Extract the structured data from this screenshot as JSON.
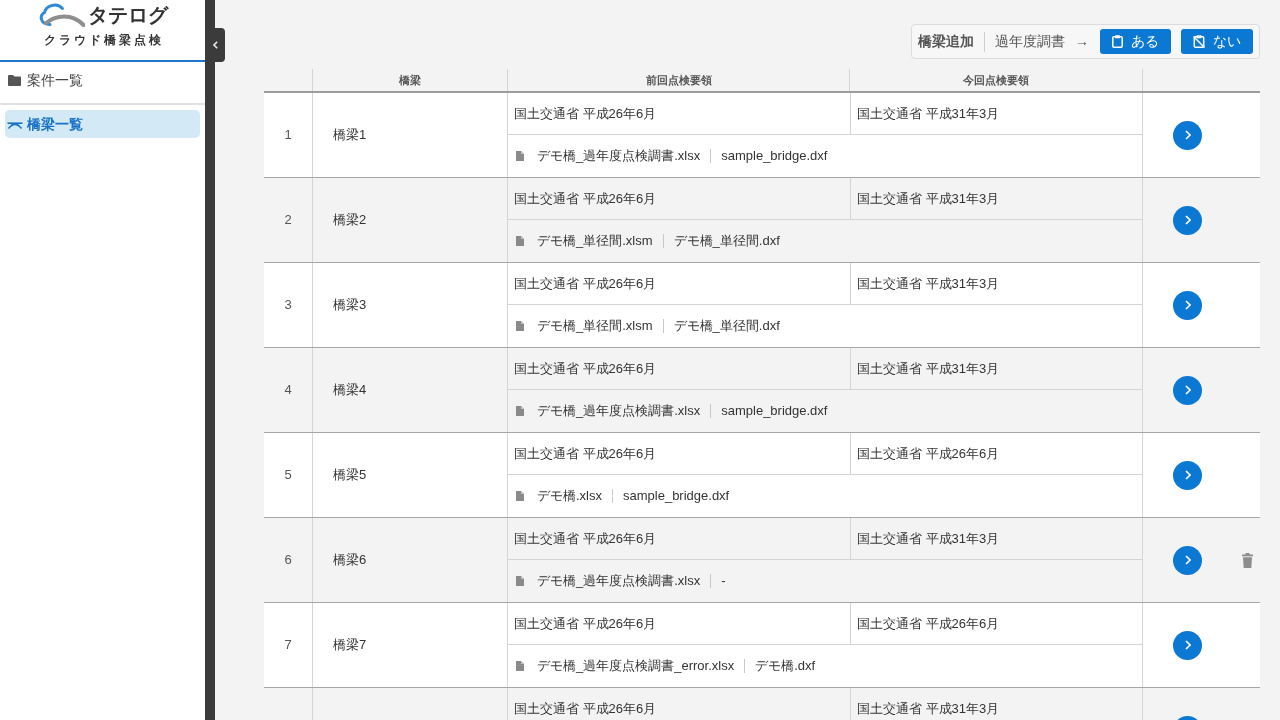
{
  "sidebar": {
    "logo": {
      "title": "タテログ",
      "subtitle": "クラウド橋梁点検"
    },
    "items": [
      {
        "label": "案件一覧",
        "kind": "folder",
        "selected": false
      },
      {
        "label": "橋梁一覧",
        "kind": "bridge",
        "selected": true
      }
    ]
  },
  "toolbar": {
    "title": "橋梁追加",
    "prompt": "過年度調書",
    "arrow": "→",
    "buttons": [
      {
        "label": "ある",
        "kind": "present"
      },
      {
        "label": "ない",
        "kind": "absent"
      }
    ]
  },
  "table": {
    "columns": [
      "橋梁",
      "前回点検要領",
      "今回点検要領"
    ],
    "rows": [
      {
        "number": "1",
        "name": "橋梁1",
        "previous": "国土交通省 平成26年6月",
        "current": "国土交通省 平成31年3月",
        "files": [
          "デモ橋_過年度点検調書.xlsx",
          "sample_bridge.dxf"
        ],
        "deletable": false
      },
      {
        "number": "2",
        "name": "橋梁2",
        "previous": "国土交通省 平成26年6月",
        "current": "国土交通省 平成31年3月",
        "files": [
          "デモ橋_単径間.xlsm",
          "デモ橋_単径間.dxf"
        ],
        "deletable": false
      },
      {
        "number": "3",
        "name": "橋梁3",
        "previous": "国土交通省 平成26年6月",
        "current": "国土交通省 平成31年3月",
        "files": [
          "デモ橋_単径間.xlsm",
          "デモ橋_単径間.dxf"
        ],
        "deletable": false
      },
      {
        "number": "4",
        "name": "橋梁4",
        "previous": "国土交通省 平成26年6月",
        "current": "国土交通省 平成31年3月",
        "files": [
          "デモ橋_過年度点検調書.xlsx",
          "sample_bridge.dxf"
        ],
        "deletable": false
      },
      {
        "number": "5",
        "name": "橋梁5",
        "previous": "国土交通省 平成26年6月",
        "current": "国土交通省 平成26年6月",
        "files": [
          "デモ橋.xlsx",
          "sample_bridge.dxf"
        ],
        "deletable": false
      },
      {
        "number": "6",
        "name": "橋梁6",
        "previous": "国土交通省 平成26年6月",
        "current": "国土交通省 平成31年3月",
        "files": [
          "デモ橋_過年度点検調書.xlsx",
          "-"
        ],
        "deletable": true
      },
      {
        "number": "7",
        "name": "橋梁7",
        "previous": "国土交通省 平成26年6月",
        "current": "国土交通省 平成26年6月",
        "files": [
          "デモ橋_過年度点検調書_error.xlsx",
          "デモ橋.dxf"
        ],
        "deletable": false
      },
      {
        "previous": "国土交通省 平成26年6月",
        "current": "国土交通省 平成31年3月",
        "deletable": false
      }
    ]
  }
}
